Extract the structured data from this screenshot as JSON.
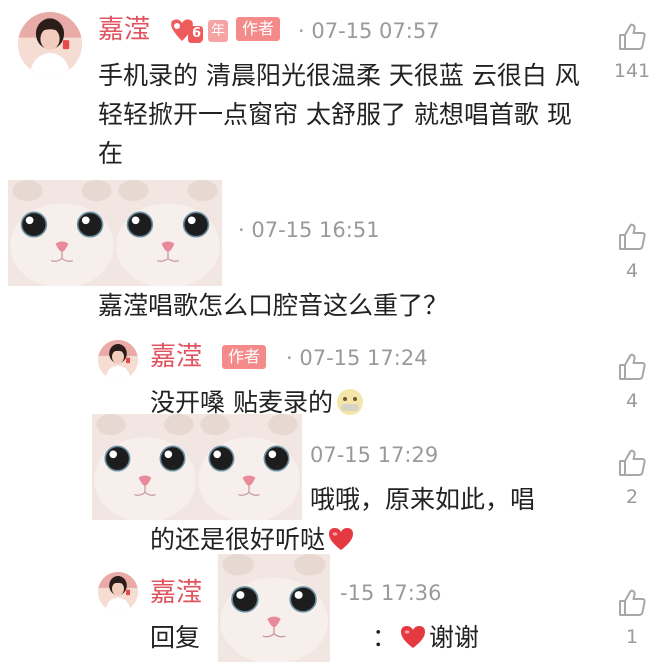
{
  "comments": [
    {
      "user": "嘉滢",
      "level": "6",
      "level_suffix": "年",
      "author_badge": "作者",
      "time": "· 07-15 07:57",
      "text": "手机录的 清晨阳光很温柔 天很蓝 云很白 风轻轻掀开一点窗帘 太舒服了 就想唱首歌 现在",
      "likes": "141"
    },
    {
      "time": "· 07-15 16:51",
      "text": "嘉滢唱歌怎么口腔音这么重了？",
      "likes": "4"
    }
  ],
  "replies": [
    {
      "user": "嘉滢",
      "author_badge": "作者",
      "time": "· 07-15 17:24",
      "text": "没开嗓 贴麦录的",
      "emoji": "mouth-covered-face-emoji",
      "likes": "4"
    },
    {
      "time": "07-15 17:29",
      "text_line1": "哦哦，原来如此，唱",
      "text_line2": "的还是很好听哒",
      "likes": "2"
    },
    {
      "user": "嘉滢",
      "time": "-15 17:36",
      "text_prefix": "回复",
      "text_suffix": "：",
      "text_end": "谢谢",
      "likes": "1"
    }
  ],
  "colors": {
    "username": "#e2535f",
    "badge": "#f58a8a",
    "heart": "#e53941",
    "meta": "#9a9a9a"
  }
}
